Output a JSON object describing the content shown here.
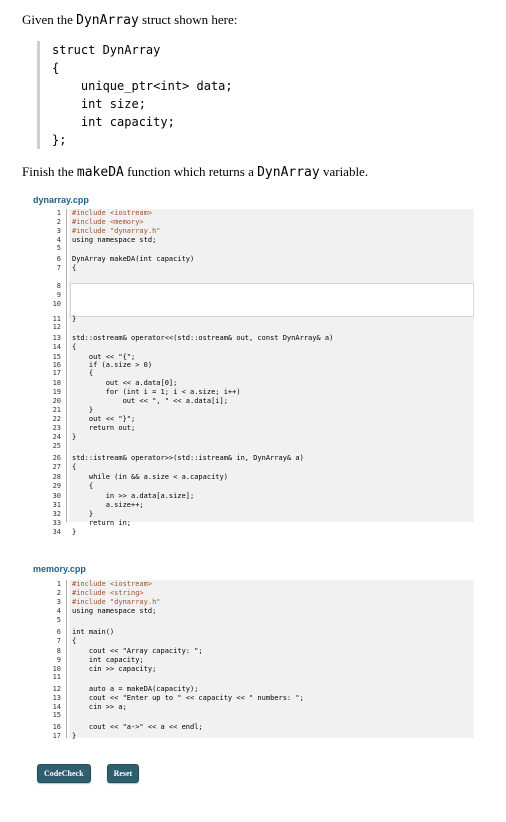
{
  "intro": {
    "before": "Given the ",
    "code": "DynArray",
    "after": " struct shown here:"
  },
  "struct_lines": [
    "struct DynArray",
    "{",
    "    unique_ptr<int> data;",
    "    int size;",
    "    int capacity;",
    "};"
  ],
  "finish": {
    "before": "Finish the ",
    "func": "makeDA",
    "middle": " function which returns a ",
    "type": "DynArray",
    "after": " variable."
  },
  "files": [
    {
      "label": "dynarray.cpp",
      "lines": [
        "#include <iostream>",
        "#include <memory>",
        "#include \"dynarray.h\"",
        "using namespace std;",
        "",
        "DynArray makeDA(int capacity)",
        "{",
        "",
        "",
        "",
        "}",
        "",
        "std::ostream& operator<<(std::ostream& out, const DynArray& a)",
        "{",
        "    out << \"{\";",
        "    if (a.size > 0)",
        "    {",
        "        out << a.data[0];",
        "        for (int i = 1; i < a.size; i++)",
        "            out << \", \" << a.data[i];",
        "    }",
        "    out << \"}\";",
        "    return out;",
        "}",
        "",
        "std::istream& operator>>(std::istream& in, DynArray& a)",
        "{",
        "    while (in && a.size < a.capacity)",
        "    {",
        "        in >> a.data[a.size];",
        "        a.size++;",
        "    }",
        "    return in;",
        "}"
      ]
    },
    {
      "label": "memory.cpp",
      "lines": [
        "#include <iostream>",
        "#include <string>",
        "#include \"dynarray.h\"",
        "using namespace std;",
        "",
        "int main()",
        "{",
        "    cout << \"Array capacity: \";",
        "    int capacity;",
        "    cin >> capacity;",
        "",
        "    auto a = makeDA(capacity);",
        "    cout << \"Enter up to \" << capacity << \" numbers: \";",
        "    cin >> a;",
        "",
        "    cout << \"a->\" << a << endl;",
        "}"
      ]
    }
  ],
  "buttons": {
    "codecheck": "CodeCheck",
    "reset": "Reset"
  }
}
